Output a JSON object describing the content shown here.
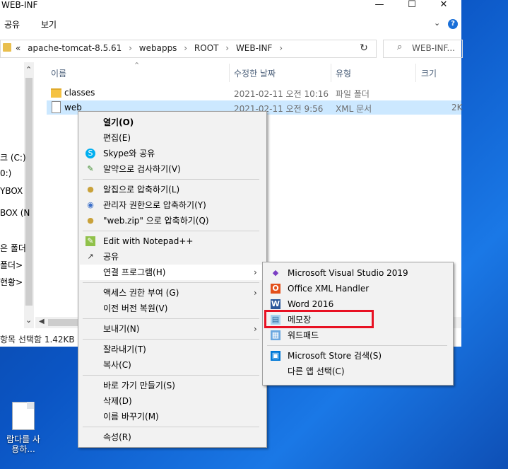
{
  "window": {
    "title": "WEB-INF",
    "min_glyph": "—",
    "max_glyph": "☐",
    "close_glyph": "✕"
  },
  "ribbon": {
    "tabs": [
      "공유",
      "보기"
    ],
    "help": "?",
    "chevron": "⌄"
  },
  "address": {
    "prefix": "«",
    "parts": [
      "apache-tomcat-8.5.61",
      "webapps",
      "ROOT",
      "WEB-INF"
    ],
    "separator": "›",
    "refresh_glyph": "↻",
    "search_placeholder": "WEB-INF..."
  },
  "nav": {
    "items": [
      "크 (C:)",
      "0:)",
      "YBOX",
      "BOX (N",
      "은 폴더",
      "폴더>",
      "현황>"
    ],
    "up_arrow": "⌃",
    "down_arrow": "⌄"
  },
  "columns": [
    "이름",
    "수정한 날짜",
    "유형",
    "크기"
  ],
  "sort_glyph": "⌃",
  "files": [
    {
      "name": "classes",
      "date": "2021-02-11 오전 10:16",
      "type": "파일 폴더",
      "size": ""
    },
    {
      "name": "web",
      "date": "2021-02-11 오전 9:56",
      "type": "XML 문서",
      "size": "2K"
    }
  ],
  "status": "항목 선택함 1.42KB",
  "context_menu": {
    "groups": [
      [
        {
          "label": "열기(O)",
          "bold": true
        },
        {
          "label": "편집(E)"
        },
        {
          "label": "Skype와 공유",
          "icon": "skype-icon"
        },
        {
          "label": "알약으로 검사하기(V)",
          "icon": "alyac-icon"
        }
      ],
      [
        {
          "label": "알집으로 압축하기(L)",
          "icon": "alzip-icon"
        },
        {
          "label": "관리자 권한으로 압축하기(Y)",
          "icon": "alzip-admin-icon"
        },
        {
          "label": "\"web.zip\" 으로 압축하기(Q)",
          "icon": "alzip-icon"
        }
      ],
      [
        {
          "label": "Edit with Notepad++",
          "icon": "notepadpp-icon"
        },
        {
          "label": "공유",
          "icon": "share-icon"
        },
        {
          "label": "연결 프로그램(H)",
          "submenu": true,
          "highlight": true
        }
      ],
      [
        {
          "label": "액세스 권한 부여 (G)",
          "submenu": true
        },
        {
          "label": "이전 버전 복원(V)"
        }
      ],
      [
        {
          "label": "보내기(N)",
          "submenu": true
        }
      ],
      [
        {
          "label": "잘라내기(T)"
        },
        {
          "label": "복사(C)"
        }
      ],
      [
        {
          "label": "바로 가기 만들기(S)"
        },
        {
          "label": "삭제(D)"
        },
        {
          "label": "이름 바꾸기(M)"
        }
      ],
      [
        {
          "label": "속성(R)"
        }
      ]
    ]
  },
  "open_with": {
    "items": [
      {
        "label": "Microsoft Visual Studio 2019",
        "icon": "visual-studio-icon"
      },
      {
        "label": "Office XML Handler",
        "icon": "office-icon"
      },
      {
        "label": "Word 2016",
        "icon": "word-icon"
      },
      {
        "label": "메모장",
        "icon": "notepad-icon",
        "highlight": true
      },
      {
        "label": "워드패드",
        "icon": "wordpad-icon"
      }
    ],
    "extra": [
      {
        "label": "Microsoft Store 검색(S)",
        "icon": "store-icon"
      },
      {
        "label": "다른 앱 선택(C)"
      }
    ],
    "highlight_color": "#e81123"
  },
  "desktop": {
    "icon_label": "람다를 사용하..."
  },
  "colors": {
    "accent": "#0078d7",
    "selection": "#cce8ff",
    "menu_hover": "#91c9f7"
  }
}
